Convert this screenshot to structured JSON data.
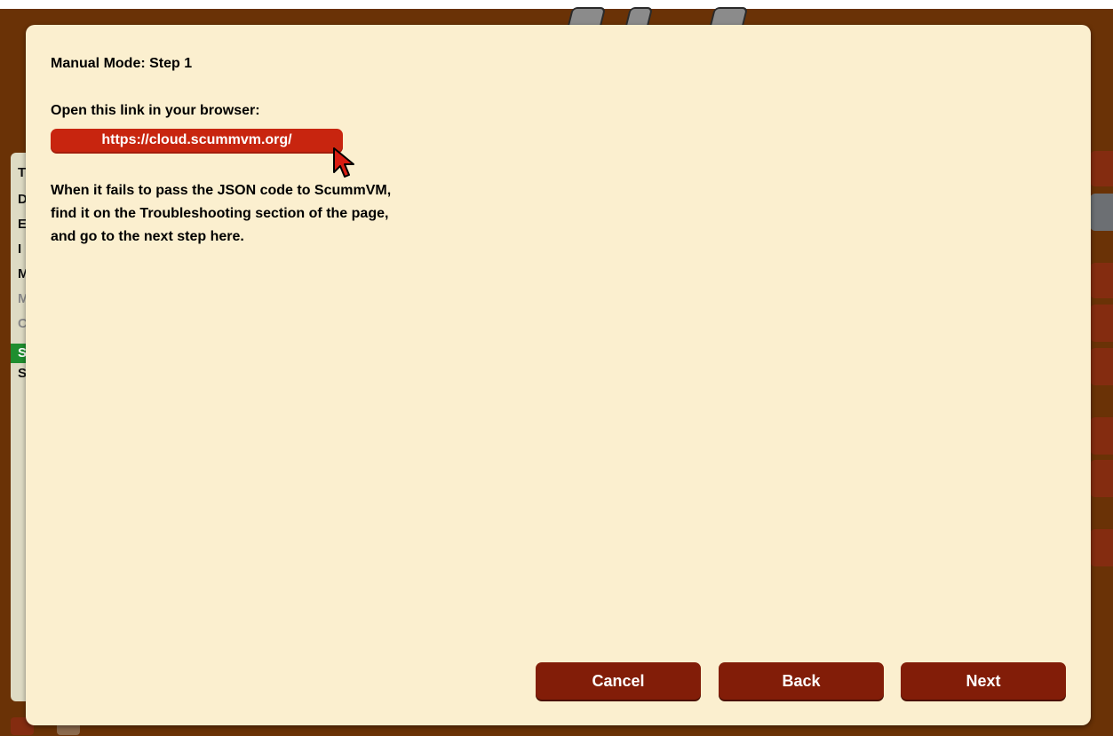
{
  "colors": {
    "background": "#6a3206",
    "dialog_background": "#fbefcf",
    "link_button": "#c8250f",
    "action_button": "#821d08",
    "highlight_green": "#1f8e2f"
  },
  "background_window": {
    "list_letters": [
      "T",
      "D",
      "E",
      "I",
      "M",
      "M",
      "C",
      "S",
      "S"
    ]
  },
  "dialog": {
    "title": "Manual Mode: Step 1",
    "instruction": "Open this link in your browser:",
    "link_label": "https://cloud.scummvm.org/",
    "help_lines": [
      "When it fails to pass the JSON code to ScummVM,",
      "find it on the Troubleshooting section of the page,",
      "and go to the next step here."
    ],
    "buttons": {
      "cancel": "Cancel",
      "back": "Back",
      "next": "Next"
    }
  },
  "pointer_icon": "arrow-cursor-icon"
}
